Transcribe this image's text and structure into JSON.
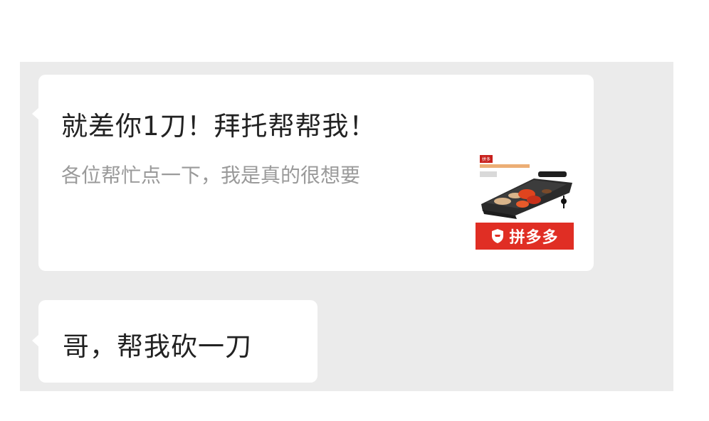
{
  "chat": {
    "link_card": {
      "title": "就差你1刀！拜托帮帮我！",
      "description": "各位帮忙点一下，我是真的很想要",
      "brand": "拼多多",
      "thumbnail_tag": "拼多",
      "thumbnail": "electric-grill-pan-product-photo"
    },
    "message": {
      "text": "哥，帮我砍一刀"
    }
  },
  "colors": {
    "chat_background": "#ebebeb",
    "bubble": "#ffffff",
    "brand_red": "#e02e24",
    "title_text": "#222222",
    "description_text": "#9a9a9a"
  }
}
